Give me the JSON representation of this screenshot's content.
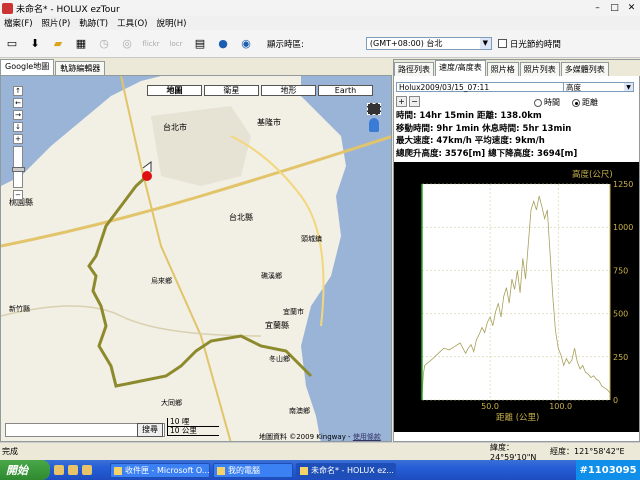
{
  "window": {
    "title": "未命名* - HOLUX ezTour"
  },
  "menu": [
    "檔案(F)",
    "照片(P)",
    "軌跡(T)",
    "工具(O)",
    "說明(H)"
  ],
  "toolbar": {
    "tz_label": "顯示時區:",
    "tz_value": "(GMT+08:00) 台北",
    "dst_label": "日光節約時間",
    "flickr": "flickr",
    "locr": "locr"
  },
  "left_tabs": [
    "Google地圖",
    "軌跡編輯器"
  ],
  "map": {
    "types": [
      "地圖",
      "衛星",
      "地形",
      "Earth"
    ],
    "labels": [
      "台北市",
      "基隆市",
      "台北縣",
      "桃園縣",
      "宜蘭縣",
      "新竹縣",
      "烏來鄉",
      "宜蘭市",
      "大同鄉",
      "南澳鄉",
      "礁溪鄉",
      "頭城鎮",
      "冬山鄉"
    ],
    "search_button": "搜尋",
    "scale": [
      "10 哩",
      "10 公里"
    ],
    "copyright": "地圖資料 ©2009 Kingway - ",
    "terms": "使用條款"
  },
  "right_tabs": [
    "路徑列表",
    "速度/高度表",
    "照片格",
    "照片列表",
    "多媒體列表"
  ],
  "track": {
    "name": "Holux2009/03/15_07:11",
    "metric": "高度"
  },
  "radios": {
    "time": "時間",
    "distance": "距離"
  },
  "stats": [
    "時間: 14hr 15min  距離: 138.0km",
    "移動時間: 9hr 1min  休息時間: 5hr 13min",
    "最大速度: 47km/h  平均速度: 9km/h",
    "總爬升高度: 3576[m]  總下降高度: 3694[m]"
  ],
  "chart_data": {
    "type": "line",
    "title": "",
    "ylabel": "高度(公尺)",
    "xlabel": "距離 (公里)",
    "xlim": [
      0,
      138
    ],
    "ylim": [
      0,
      1250
    ],
    "xticks": [
      "50.0",
      "100.0"
    ],
    "yticks": [
      "0",
      "250",
      "500",
      "750",
      "1000",
      "1250"
    ],
    "series": [
      {
        "x": [
          0,
          1,
          2,
          5,
          8,
          12,
          16,
          20,
          24,
          28,
          30,
          32,
          34,
          36,
          38,
          40,
          42,
          44,
          46,
          48,
          50,
          52,
          54,
          56,
          58,
          60,
          62,
          64,
          66,
          68,
          70,
          72,
          74,
          76,
          78,
          80,
          82,
          84,
          86,
          88,
          90,
          92,
          94,
          96,
          98,
          100,
          102,
          104,
          106,
          108,
          110,
          112,
          114,
          116,
          118,
          120,
          122,
          124,
          126,
          128,
          130,
          132,
          134,
          136,
          138
        ],
        "values": [
          20,
          150,
          200,
          220,
          240,
          270,
          300,
          290,
          310,
          330,
          300,
          270,
          300,
          320,
          280,
          350,
          380,
          420,
          390,
          450,
          480,
          430,
          510,
          560,
          480,
          600,
          650,
          560,
          700,
          640,
          750,
          620,
          820,
          700,
          900,
          1100,
          1150,
          1100,
          1180,
          1120,
          1050,
          1100,
          850,
          600,
          400,
          300,
          260,
          200,
          240,
          210,
          230,
          300,
          220,
          180,
          200,
          160,
          150,
          130,
          140,
          120,
          110,
          80,
          70,
          60,
          40
        ]
      }
    ]
  },
  "status": {
    "left": "完成",
    "lat": "緯度：24°59'10\"N",
    "lon": "經度：121°58'42\"E"
  },
  "taskbar": {
    "start": "開始",
    "tasks": [
      "收件匣 - Microsoft O...",
      "我的電腦",
      "未命名* - HOLUX ez..."
    ],
    "watermark": "#1103095"
  }
}
